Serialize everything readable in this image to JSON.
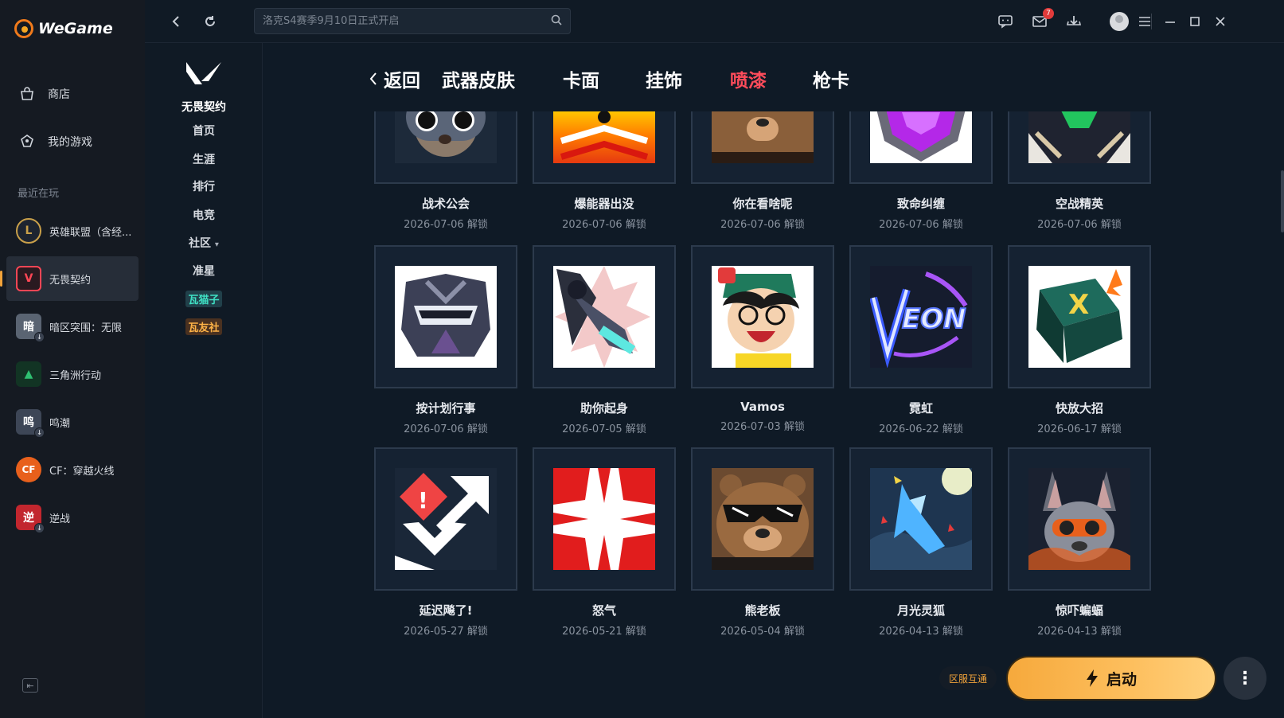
{
  "app": {
    "brand": "WeGame"
  },
  "sidebar": {
    "items": [
      {
        "label": "商店",
        "icon": "bag-icon"
      },
      {
        "label": "我的游戏",
        "icon": "controller-icon"
      }
    ],
    "recent_title": "最近在玩",
    "games": [
      {
        "label": "英雄联盟（含经...",
        "color": "#c9a04a",
        "glyph": "L",
        "download": false,
        "active": false
      },
      {
        "label": "无畏契约",
        "color": "#ff4655",
        "glyph": "V",
        "download": false,
        "active": true
      },
      {
        "label": "暗区突围：无限",
        "color": "#6b7785",
        "glyph": "暗",
        "download": true,
        "active": false
      },
      {
        "label": "三角洲行动",
        "color": "#2fbf71",
        "glyph": "▲",
        "download": false,
        "active": false
      },
      {
        "label": "鸣潮",
        "color": "#4a5568",
        "glyph": "鸣",
        "download": true,
        "active": false
      },
      {
        "label": "CF：穿越火线",
        "color": "#e8601c",
        "glyph": "CF",
        "download": false,
        "active": false
      },
      {
        "label": "逆战",
        "color": "#c2262e",
        "glyph": "逆",
        "download": true,
        "active": false
      }
    ]
  },
  "topbar": {
    "search_placeholder": "洛克S4赛季9月10日正式开启",
    "mail_badge": "7"
  },
  "subnav": {
    "logo_text": "无畏契约",
    "items": [
      "首页",
      "生涯",
      "排行",
      "电竞",
      "社区",
      "准星"
    ],
    "community_caret": "▾",
    "pill_1": "瓦猫子",
    "pill_2": "瓦友社"
  },
  "tabs": {
    "back": "返回",
    "items": [
      "武器皮肤",
      "卡面",
      "挂饰",
      "喷漆",
      "枪卡"
    ],
    "active": "喷漆"
  },
  "sprays": [
    {
      "title": "战术公会",
      "date": "2026-07-06 解锁",
      "clipped": true
    },
    {
      "title": "爆能器出没",
      "date": "2026-07-06 解锁",
      "clipped": true
    },
    {
      "title": "你在看啥呢",
      "date": "2026-07-06 解锁",
      "clipped": true
    },
    {
      "title": "致命纠缠",
      "date": "2026-07-06 解锁",
      "clipped": true
    },
    {
      "title": "空战精英",
      "date": "2026-07-06 解锁",
      "clipped": true
    },
    {
      "title": "按计划行事",
      "date": "2026-07-06 解锁",
      "clipped": false
    },
    {
      "title": "助你起身",
      "date": "2026-07-05 解锁",
      "clipped": false
    },
    {
      "title": "Vamos",
      "date": "2026-07-03 解锁",
      "clipped": false
    },
    {
      "title": "霓虹",
      "date": "2026-06-22 解锁",
      "clipped": false
    },
    {
      "title": "快放大招",
      "date": "2026-06-17 解锁",
      "clipped": false
    },
    {
      "title": "延迟飚了!",
      "date": "2026-05-27 解锁",
      "clipped": false
    },
    {
      "title": "怒气",
      "date": "2026-05-21 解锁",
      "clipped": false
    },
    {
      "title": "熊老板",
      "date": "2026-05-04 解锁",
      "clipped": false
    },
    {
      "title": "月光灵狐",
      "date": "2026-04-13 解锁",
      "clipped": false
    },
    {
      "title": "惊吓蝙蝠",
      "date": "2026-04-13 解锁",
      "clipped": false
    }
  ],
  "footer": {
    "region_label": "区服互通",
    "launch_label": "启动",
    "more_label": "⋮"
  },
  "colors": {
    "accent_active_tab": "#ff4c5b",
    "launch_button": "#f6a93c"
  }
}
